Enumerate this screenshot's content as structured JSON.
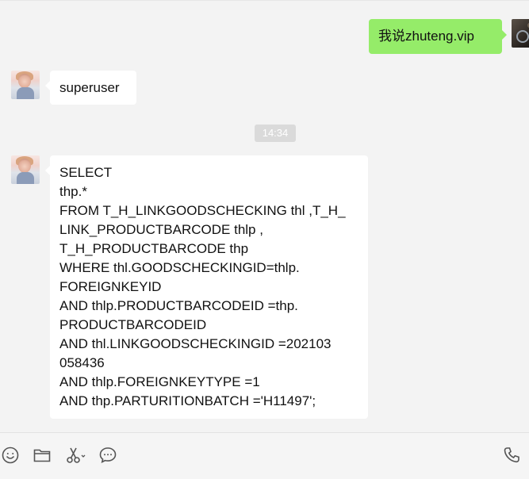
{
  "conversation": {
    "messages": [
      {
        "sender": "self",
        "text": "我说zhuteng.vip"
      },
      {
        "sender": "other",
        "text": "superuser"
      },
      {
        "sender": "other",
        "text": "SELECT\nthp.*\nFROM T_H_LINKGOODSCHECKING thl ,T_H_\nLINK_PRODUCTBARCODE thlp ,\nT_H_PRODUCTBARCODE thp\nWHERE thl.GOODSCHECKINGID=thlp.\nFOREIGNKEYID\nAND thlp.PRODUCTBARCODEID =thp.\nPRODUCTBARCODEID\nAND thl.LINKGOODSCHECKINGID =202103\n058436\nAND thlp.FOREIGNKEYTYPE =1\nAND thp.PARTURITIONBATCH ='H11497';"
      }
    ],
    "timestamp": "14:34"
  },
  "colors": {
    "self_bubble": "#95ec69",
    "other_bubble": "#ffffff",
    "background": "#f3f3f3",
    "timestamp_bg": "#dadada"
  },
  "toolbar": {
    "icons": [
      "emoji-icon",
      "folder-icon",
      "scissors-icon",
      "chat-history-icon",
      "phone-icon"
    ]
  }
}
